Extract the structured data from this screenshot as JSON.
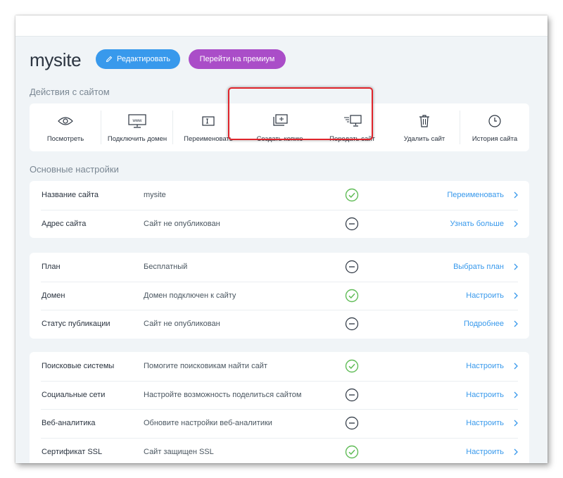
{
  "header": {
    "site_name": "mysite",
    "edit_label": "Редактировать",
    "premium_label": "Перейти на премиум"
  },
  "actions": {
    "title": "Действия с сайтом",
    "items": [
      {
        "label": "Посмотреть",
        "icon": "eye-icon"
      },
      {
        "label": "Подключить домен",
        "icon": "www-monitor-icon"
      },
      {
        "label": "Переименовать",
        "icon": "rename-icon"
      },
      {
        "label": "Создать копию",
        "icon": "duplicate-icon"
      },
      {
        "label": "Передать сайт",
        "icon": "transfer-icon"
      },
      {
        "label": "Удалить сайт",
        "icon": "trash-icon"
      },
      {
        "label": "История сайта",
        "icon": "clock-icon"
      }
    ]
  },
  "settings": {
    "title": "Основные настройки",
    "groups": [
      [
        {
          "name": "Название сайта",
          "value": "mysite",
          "status": "ok",
          "link": "Переименовать"
        },
        {
          "name": "Адрес сайта",
          "value": "Сайт не опубликован",
          "status": "neutral",
          "link": "Узнать больше"
        }
      ],
      [
        {
          "name": "План",
          "value": "Бесплатный",
          "status": "neutral",
          "link": "Выбрать план"
        },
        {
          "name": "Домен",
          "value": "Домен подключен к сайту",
          "status": "ok",
          "link": "Настроить"
        },
        {
          "name": "Статус публикации",
          "value": "Сайт не опубликован",
          "status": "neutral",
          "link": "Подробнее"
        }
      ],
      [
        {
          "name": "Поисковые системы",
          "value": "Помогите поисковикам найти сайт",
          "status": "ok",
          "link": "Настроить"
        },
        {
          "name": "Социальные сети",
          "value": "Настройте возможность поделиться сайтом",
          "status": "neutral",
          "link": "Настроить"
        },
        {
          "name": "Веб-аналитика",
          "value": "Обновите настройки веб-аналитики",
          "status": "neutral",
          "link": "Настроить"
        },
        {
          "name": "Сертификат SSL",
          "value": "Сайт защищен SSL",
          "status": "ok",
          "link": "Настроить"
        }
      ]
    ]
  },
  "colors": {
    "accent": "#3899ec",
    "premium": "#aa4dc8",
    "ok": "#60bc57",
    "neutral": "#2b3440",
    "highlight": "#e0242b"
  }
}
